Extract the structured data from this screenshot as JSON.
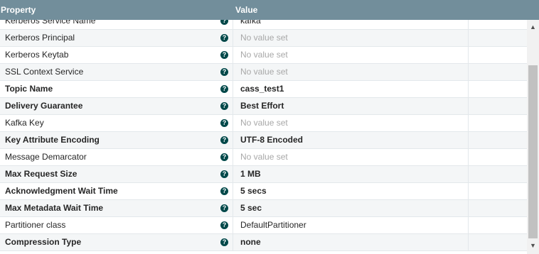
{
  "header": {
    "property": "Property",
    "value": "Value"
  },
  "help_icon": "question-circle-icon",
  "rows": [
    {
      "name": "Kerberos Service Name",
      "value": "kafka",
      "required": false,
      "unset": false
    },
    {
      "name": "Kerberos Principal",
      "value": "No value set",
      "required": false,
      "unset": true
    },
    {
      "name": "Kerberos Keytab",
      "value": "No value set",
      "required": false,
      "unset": true
    },
    {
      "name": "SSL Context Service",
      "value": "No value set",
      "required": false,
      "unset": true
    },
    {
      "name": "Topic Name",
      "value": "cass_test1",
      "required": true,
      "unset": false
    },
    {
      "name": "Delivery Guarantee",
      "value": "Best Effort",
      "required": true,
      "unset": false
    },
    {
      "name": "Kafka Key",
      "value": "No value set",
      "required": false,
      "unset": true
    },
    {
      "name": "Key Attribute Encoding",
      "value": "UTF-8 Encoded",
      "required": true,
      "unset": false
    },
    {
      "name": "Message Demarcator",
      "value": "No value set",
      "required": false,
      "unset": true
    },
    {
      "name": "Max Request Size",
      "value": "1 MB",
      "required": true,
      "unset": false
    },
    {
      "name": "Acknowledgment Wait Time",
      "value": "5 secs",
      "required": true,
      "unset": false
    },
    {
      "name": "Max Metadata Wait Time",
      "value": "5 sec",
      "required": true,
      "unset": false
    },
    {
      "name": "Partitioner class",
      "value": "DefaultPartitioner",
      "required": false,
      "unset": false
    },
    {
      "name": "Compression Type",
      "value": "none",
      "required": true,
      "unset": false
    }
  ]
}
